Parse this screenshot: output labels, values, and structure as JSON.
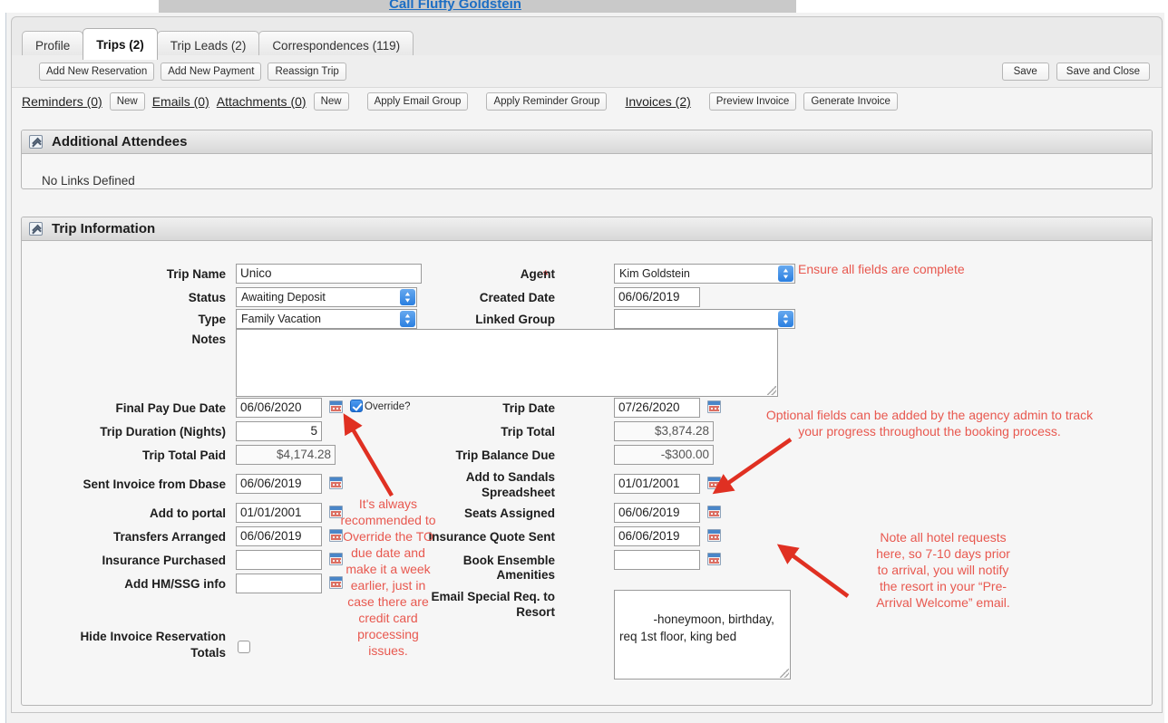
{
  "header": {
    "call_link": "Call Fluffy Goldstein"
  },
  "tabs": [
    {
      "label": "Profile",
      "active": false
    },
    {
      "label": "Trips (2)",
      "active": true
    },
    {
      "label": "Trip Leads (2)",
      "active": false
    },
    {
      "label": "Correspondences (119)",
      "active": false
    }
  ],
  "toolbar": {
    "add_new_reservation": "Add New Reservation",
    "add_new_payment": "Add New Payment",
    "reassign_trip": "Reassign Trip",
    "save": "Save",
    "save_and_close": "Save and Close"
  },
  "links_row": {
    "reminders": "Reminders (0)",
    "reminders_new": "New",
    "emails": "Emails (0)",
    "attachments": "Attachments (0)",
    "attachments_new": "New",
    "apply_email_group": "Apply Email Group",
    "apply_reminder_group": "Apply Reminder Group",
    "invoices": "Invoices (2)",
    "preview_invoice": "Preview Invoice",
    "generate_invoice": "Generate Invoice"
  },
  "attendees_section": {
    "title": "Additional Attendees",
    "body_text": "No Links Defined"
  },
  "trip_section": {
    "title": "Trip Information",
    "labels": {
      "trip_name": "Trip Name",
      "status": "Status",
      "type": "Type",
      "notes": "Notes",
      "agent": "Agent",
      "agent_required_mark": "*",
      "created_date": "Created Date",
      "linked_group": "Linked Group",
      "final_pay_due_date": "Final Pay Due Date",
      "trip_duration": "Trip Duration (Nights)",
      "trip_total_paid": "Trip Total Paid",
      "sent_invoice_from_dbase": "Sent Invoice from Dbase",
      "add_to_portal": "Add to portal",
      "transfers_arranged": "Transfers Arranged",
      "insurance_purchased": "Insurance Purchased",
      "add_hm_ssg_info": "Add HM/SSG info",
      "hide_invoice_totals": "Hide Invoice Reservation Totals",
      "trip_date": "Trip Date",
      "trip_total": "Trip Total",
      "trip_balance_due": "Trip Balance Due",
      "add_to_sandals": "Add to Sandals Spreadsheet",
      "seats_assigned": "Seats Assigned",
      "insurance_quote_sent": "Insurance Quote Sent",
      "book_ensemble_amenities": "Book Ensemble Amenities",
      "email_special_req": "Email Special Req. to Resort",
      "override": "Override?"
    },
    "values": {
      "trip_name": "Unico",
      "status": "Awaiting Deposit",
      "type": "Family Vacation",
      "notes": "",
      "agent": "Kim Goldstein",
      "created_date": "06/06/2019",
      "linked_group": "",
      "final_pay_due_date": "06/06/2020",
      "trip_duration": "5",
      "trip_total_paid": "$4,174.28",
      "sent_invoice_from_dbase": "06/06/2019",
      "add_to_portal": "01/01/2001",
      "transfers_arranged": "06/06/2019",
      "insurance_purchased": "",
      "add_hm_ssg_info": "",
      "trip_date": "07/26/2020",
      "trip_total": "$3,874.28",
      "trip_balance_due": "-$300.00",
      "add_to_sandals": "01/01/2001",
      "seats_assigned": "06/06/2019",
      "insurance_quote_sent": "06/06/2019",
      "book_ensemble_amenities": "",
      "email_special_req": "-honeymoon, birthday, req 1st floor, king bed"
    },
    "checkboxes": {
      "override_checked": true,
      "hide_invoice_checked": false
    }
  },
  "annotations": {
    "ensure_fields": "Ensure all fields are complete",
    "optional_fields": "Optional fields can be added by the agency admin to track\nyour progress throughout the booking process.",
    "override_note": "It's always\nrecommended to\nOverride the TO\ndue date and\nmake it a week\nearlier, just in\ncase there are\ncredit card\nprocessing\nissues.",
    "hotel_requests_note": "Note all hotel requests\nhere, so 7-10 days prior\nto arrival, you will notify\nthe resort in your “Pre-\nArrival Welcome” email."
  },
  "colors": {
    "annotation_red": "#e8584f",
    "link_blue": "#1c6ec4",
    "required_red": "#cc2a2a"
  }
}
